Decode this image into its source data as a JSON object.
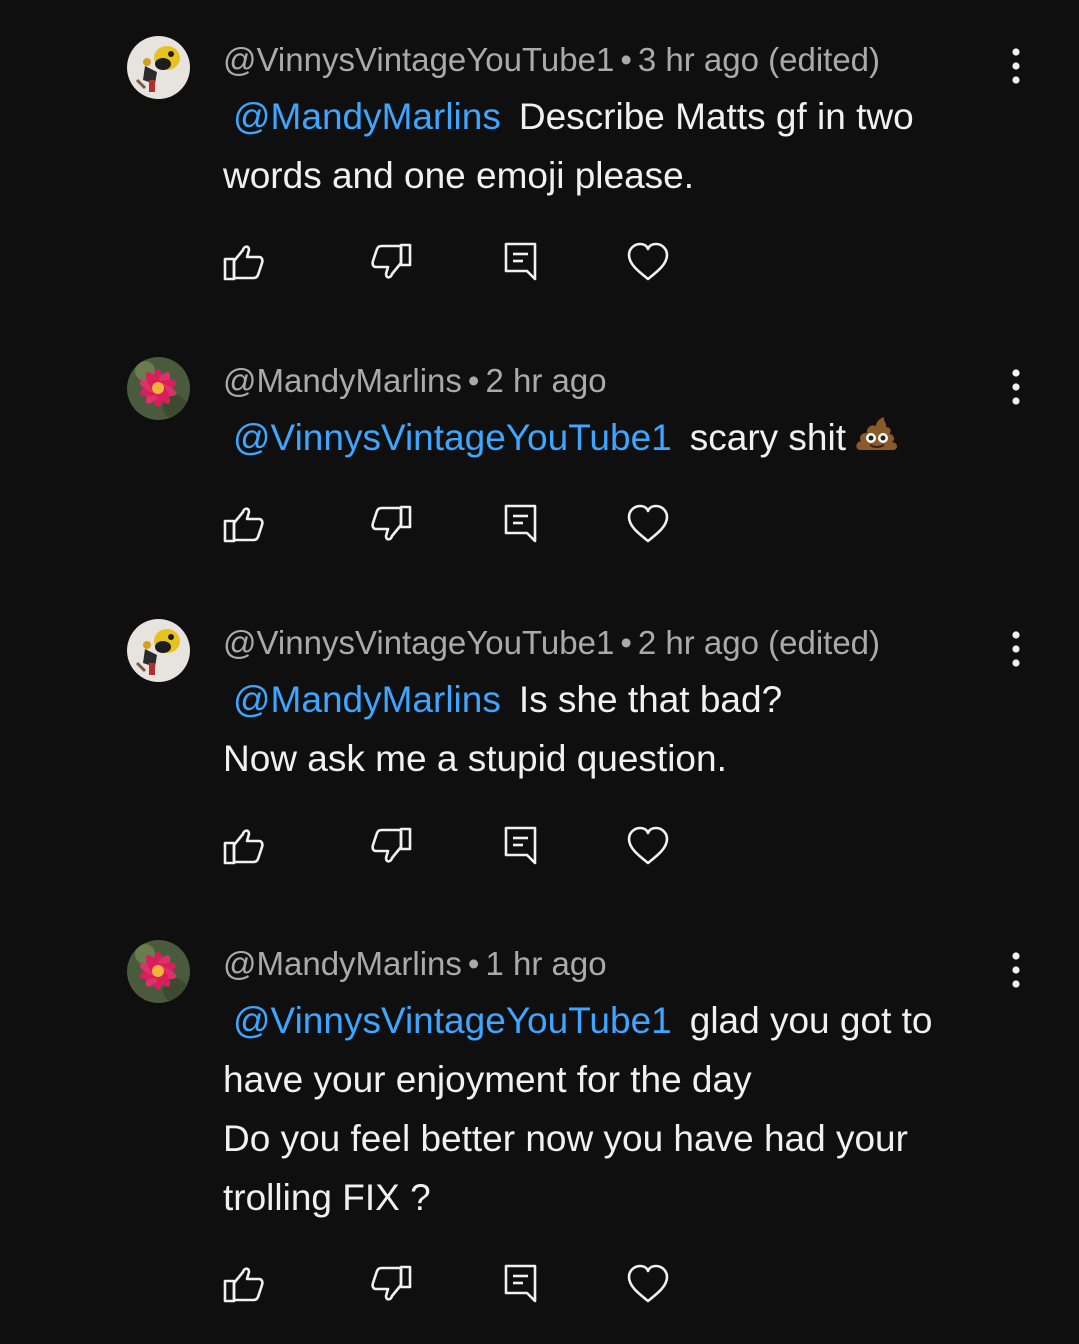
{
  "comments": [
    {
      "avatar": "toy-avatar",
      "author": "@VinnysVintageYouTube1",
      "separator": "•",
      "time": "3 hr ago (edited)",
      "mention": "@MandyMarlins",
      "lines": [
        "Describe Matts gf in two",
        "words and one emoji please."
      ],
      "first_line_text": "Describe Matts gf in two",
      "rest_lines": [
        "words and one emoji please."
      ]
    },
    {
      "avatar": "flower-avatar",
      "author": "@MandyMarlins",
      "separator": "•",
      "time": "2 hr ago",
      "mention": "@VinnysVintageYouTube1",
      "first_line_text": "scary shit",
      "emoji": "pile-of-poo-emoji",
      "rest_lines": []
    },
    {
      "avatar": "toy-avatar",
      "author": "@VinnysVintageYouTube1",
      "separator": "•",
      "time": "2 hr ago (edited)",
      "mention": "@MandyMarlins",
      "first_line_text": "Is she that bad?",
      "rest_lines": [
        "Now ask me a stupid question."
      ]
    },
    {
      "avatar": "flower-avatar",
      "author": "@MandyMarlins",
      "separator": "•",
      "time": "1 hr ago",
      "mention": "@VinnysVintageYouTube1",
      "first_line_text": "glad you got to",
      "rest_lines": [
        "have your enjoyment for the day",
        "Do you feel better now you have had your",
        "trolling FIX ?"
      ]
    }
  ],
  "icons": {
    "like": "thumbs-up-icon",
    "dislike": "thumbs-down-icon",
    "reply": "reply-icon",
    "heart": "heart-icon",
    "more": "more-vertical-icon"
  },
  "colors": {
    "background": "#0f0f0f",
    "text": "#f1f1f1",
    "meta": "#aaaaaa",
    "mention": "#3ea6ff"
  }
}
